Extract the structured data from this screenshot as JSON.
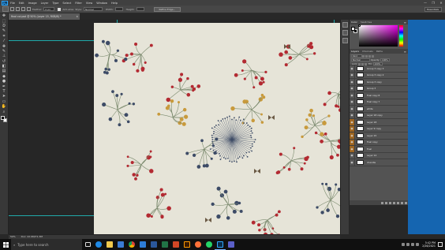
{
  "app": {
    "logo": "Ps"
  },
  "menu": [
    "File",
    "Edit",
    "Image",
    "Layer",
    "Type",
    "Select",
    "Filter",
    "View",
    "Window",
    "Help"
  ],
  "window_controls": [
    "—",
    "❐",
    "✕"
  ],
  "options_bar": {
    "feather_label": "Feather:",
    "feather_value": "0 px",
    "antialias_label": "Anti-alias",
    "style_label": "Style:",
    "style_value": "Normal",
    "width_label": "Width:",
    "height_label": "Height:",
    "refine_button": "Refine Edge...",
    "workspace": "Essentials"
  },
  "document": {
    "tab_title": "final col.psd @ 50% (Layer 15, RGB/8) *",
    "close": "×",
    "status_zoom": "50%",
    "status_doc": "Doc: 22.9M/71.3M"
  },
  "tools": [
    {
      "name": "move-tool-icon",
      "glyph": "✥"
    },
    {
      "name": "marquee-tool-icon",
      "glyph": "⬚"
    },
    {
      "name": "lasso-tool-icon",
      "glyph": "ᘐ"
    },
    {
      "name": "quick-select-tool-icon",
      "glyph": "✎"
    },
    {
      "name": "crop-tool-icon",
      "glyph": "⌗"
    },
    {
      "name": "eyedropper-tool-icon",
      "glyph": "⁄"
    },
    {
      "name": "healing-brush-tool-icon",
      "glyph": "✚"
    },
    {
      "name": "brush-tool-icon",
      "glyph": "✎"
    },
    {
      "name": "clone-stamp-tool-icon",
      "glyph": "⊥"
    },
    {
      "name": "history-brush-tool-icon",
      "glyph": "↺"
    },
    {
      "name": "eraser-tool-icon",
      "glyph": "◧"
    },
    {
      "name": "gradient-tool-icon",
      "glyph": "▤"
    },
    {
      "name": "blur-tool-icon",
      "glyph": "◆"
    },
    {
      "name": "dodge-tool-icon",
      "glyph": "●"
    },
    {
      "name": "pen-tool-icon",
      "glyph": "✒"
    },
    {
      "name": "type-tool-icon",
      "glyph": "T"
    },
    {
      "name": "path-select-tool-icon",
      "glyph": "➤"
    },
    {
      "name": "shape-tool-icon",
      "glyph": "▭"
    },
    {
      "name": "hand-tool-icon",
      "glyph": "✋"
    },
    {
      "name": "zoom-tool-icon",
      "glyph": "⌕"
    }
  ],
  "panels": {
    "color_tabs": [
      "Color",
      "Swatches"
    ],
    "layer_tabs": [
      "Layers",
      "Channels",
      "Paths"
    ],
    "kind_label": "Kind",
    "blend_mode": "Normal",
    "opacity_label": "Opacity:",
    "opacity_value": "100%",
    "lock_label": "Lock:",
    "fill_label": "Fill:",
    "fill_value": "100%"
  },
  "layers": [
    {
      "name": "Group 3 copy 3",
      "tinted": false
    },
    {
      "name": "Group 3 copy 2",
      "tinted": false
    },
    {
      "name": "Group 3 copy",
      "tinted": false
    },
    {
      "name": "Group 3",
      "tinted": false
    },
    {
      "name": "final copy 8",
      "tinted": false
    },
    {
      "name": "final copy 7",
      "tinted": false
    },
    {
      "name": "white",
      "tinted": false
    },
    {
      "name": "Layer 18 copy",
      "tinted": false
    },
    {
      "name": "Layer 18",
      "tinted": true
    },
    {
      "name": "Layer 9 copy",
      "tinted": true
    },
    {
      "name": "Layer 15",
      "tinted": true
    },
    {
      "name": "final copy",
      "tinted": true
    },
    {
      "name": "final",
      "tinted": true
    },
    {
      "name": "Layer 14",
      "tinted": false
    },
    {
      "name": "chandle",
      "tinted": false
    }
  ],
  "taskbar": {
    "search_placeholder": "Type here to search",
    "time": "5:42 PM",
    "date": "2/26/2021"
  },
  "colors": {
    "canvas_bg": "#e6e4d8",
    "flower_red": "#b32a32",
    "flower_navy": "#3d4b66",
    "stem_green": "#7b8a6e",
    "accent_gold": "#c89a3c",
    "guide_cyan": "#1fd5d5",
    "taskbar_blue": "#1565b0"
  }
}
